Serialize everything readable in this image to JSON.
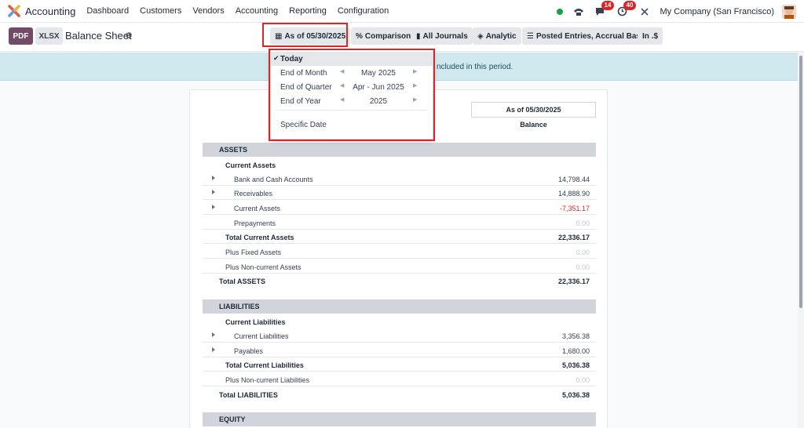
{
  "nav": {
    "app_name": "Accounting",
    "menu": [
      "Dashboard",
      "Customers",
      "Vendors",
      "Accounting",
      "Reporting",
      "Configuration"
    ],
    "messages_count": "14",
    "activities_count": "40",
    "company": "My Company (San Francisco)"
  },
  "control_panel": {
    "pdf_label": "PDF",
    "xlsx_label": "XLSX",
    "title": "Balance Sheet",
    "filters": {
      "date": "As of 05/30/2025",
      "comparison": "Comparison",
      "journals": "All Journals",
      "analytic": "Analytic",
      "entries": "Posted Entries, Accrual Basis",
      "currency": "In .$"
    }
  },
  "banner": {
    "text": "ncluded in this period."
  },
  "report": {
    "column_header": "As of 05/30/2025",
    "column_sub": "Balance",
    "sections": {
      "assets": "ASSETS",
      "liabilities": "LIABILITIES",
      "equity": "EQUITY"
    },
    "rows": [
      {
        "label": "Current Assets",
        "value": ""
      },
      {
        "label": "Bank and Cash Accounts",
        "value": "14,798.44"
      },
      {
        "label": "Receivables",
        "value": "14,888.90"
      },
      {
        "label": "Current Assets",
        "value": "-7,351.17"
      },
      {
        "label": "Prepayments",
        "value": "0.00"
      },
      {
        "label": "Total Current Assets",
        "value": "22,336.17"
      },
      {
        "label": "Plus Fixed Assets",
        "value": "0.00"
      },
      {
        "label": "Plus Non-current Assets",
        "value": "0.00"
      },
      {
        "label": "Total ASSETS",
        "value": "22,336.17"
      },
      {
        "label": "Current Liabilities",
        "value": ""
      },
      {
        "label": "Current Liabilities",
        "value": "3,356.38"
      },
      {
        "label": "Payables",
        "value": "1,680.00"
      },
      {
        "label": "Total Current Liabilities",
        "value": "5,036.38"
      },
      {
        "label": "Plus Non-current Liabilities",
        "value": "0.00"
      },
      {
        "label": "Total LIABILITIES",
        "value": "5,036.38"
      }
    ]
  },
  "date_dropdown": {
    "today": "Today",
    "options": [
      {
        "label": "End of Month",
        "value": "May 2025"
      },
      {
        "label": "End of Quarter",
        "value": "Apr - Jun 2025"
      },
      {
        "label": "End of Year",
        "value": "2025"
      }
    ],
    "specific": "Specific Date"
  },
  "colors": {
    "brand": "#714b67",
    "negative": "#dc2626",
    "highlight": "#dc2626",
    "banner": "#cfe9ef",
    "online": "#16a34a"
  }
}
